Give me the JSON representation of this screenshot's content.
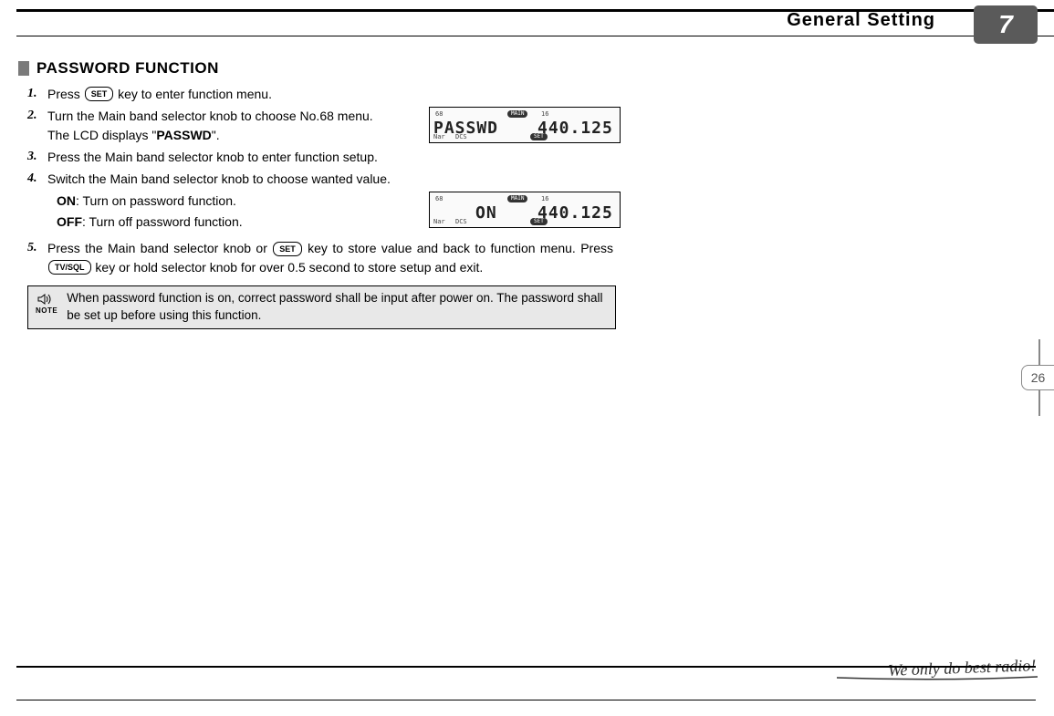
{
  "header": {
    "title": "General Setting",
    "chapter": "7"
  },
  "section": {
    "title": "PASSWORD FUNCTION"
  },
  "keys": {
    "set": "SET",
    "tvsql": "TV/SQL"
  },
  "steps": {
    "s1": {
      "num": "1.",
      "pre": "Press ",
      "post": " key to enter function menu."
    },
    "s2": {
      "num": "2.",
      "text_a": "Turn the Main band selector knob to choose No.68 menu. The LCD displays \"",
      "bold": "PASSWD",
      "text_b": "\"."
    },
    "s3": {
      "num": "3.",
      "text": "Press the Main band selector knob to enter function setup."
    },
    "s4": {
      "num": "4.",
      "text": "Switch the Main band selector knob to choose wanted value."
    },
    "s4sub": {
      "on_b": "ON",
      "on_t": ": Turn on password function.",
      "off_b": "OFF",
      "off_t": ": Turn off password function."
    },
    "s5": {
      "num": "5.",
      "a": "Press the Main band selector knob or ",
      "b": " key to store value and back to function menu. Press ",
      "c": " key or hold selector knob for over 0.5 second to store setup and exit."
    }
  },
  "lcd1": {
    "num_left": "68",
    "main_left": "PASSWD",
    "num_right": "16",
    "main_right": "440.125",
    "badge_top": "MAIN",
    "badge_bot": "SET",
    "tl1": "Nar",
    "tl2": "DCS"
  },
  "lcd2": {
    "num_left": "68",
    "main_left": "ON",
    "num_right": "16",
    "main_right": "440.125",
    "badge_top": "MAIN",
    "badge_bot": "SET",
    "tl1": "Nar",
    "tl2": "DCS"
  },
  "note": {
    "label": "NOTE",
    "text": "When password function is on, correct password shall be input after power on. The password shall be set up before using this function."
  },
  "page": {
    "number": "26"
  },
  "footer": {
    "slogan": "We only do best radio!"
  }
}
